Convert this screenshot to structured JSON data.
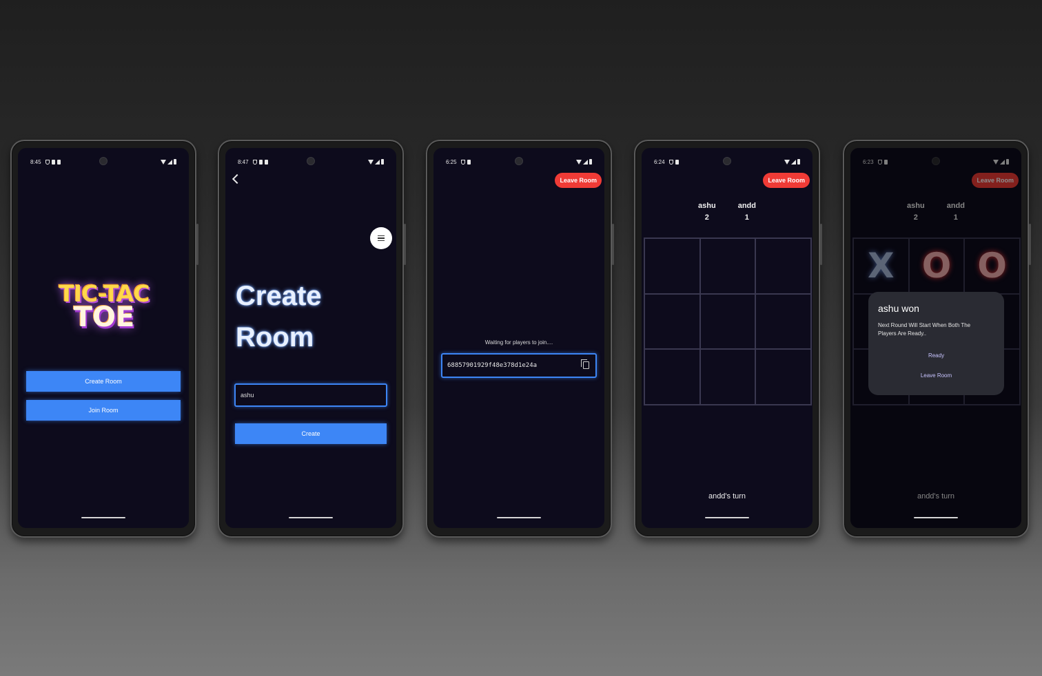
{
  "colors": {
    "screen_bg": "#0d0b1c",
    "primary_blue": "#3d86f6",
    "leave_red": "#ef3b36",
    "dialog_bg": "#2a2b33"
  },
  "phone1": {
    "time": "8:45",
    "logo_line1": "TIC-TAC",
    "logo_line2": "TOE",
    "create_room_label": "Create Room",
    "join_room_label": "Join Room"
  },
  "phone2": {
    "time": "8:47",
    "title_line1": "Create",
    "title_line2": "Room",
    "name_value": "ashu",
    "create_label": "Create"
  },
  "phone3": {
    "time": "6:25",
    "leave_label": "Leave Room",
    "waiting_text": "Waiting for players to join....",
    "room_id": "68857901929f48e378d1e24a"
  },
  "phone4": {
    "time": "6:24",
    "leave_label": "Leave Room",
    "players": [
      {
        "name": "ashu",
        "score": "2"
      },
      {
        "name": "andd",
        "score": "1"
      }
    ],
    "board": [
      "",
      "",
      "",
      "",
      "",
      "",
      "",
      "",
      ""
    ],
    "turn_text": "andd's turn"
  },
  "phone5": {
    "time": "6:23",
    "leave_label": "Leave Room",
    "players": [
      {
        "name": "ashu",
        "score": "2"
      },
      {
        "name": "andd",
        "score": "1"
      }
    ],
    "board": [
      "X",
      "O",
      "O",
      "",
      "",
      "",
      "",
      "",
      ""
    ],
    "turn_text": "andd's turn",
    "dialog": {
      "title": "ashu won",
      "message": "Next Round Will Start When Both The Players Are Ready..",
      "ready_label": "Ready",
      "leave_label": "Leave Room"
    }
  }
}
